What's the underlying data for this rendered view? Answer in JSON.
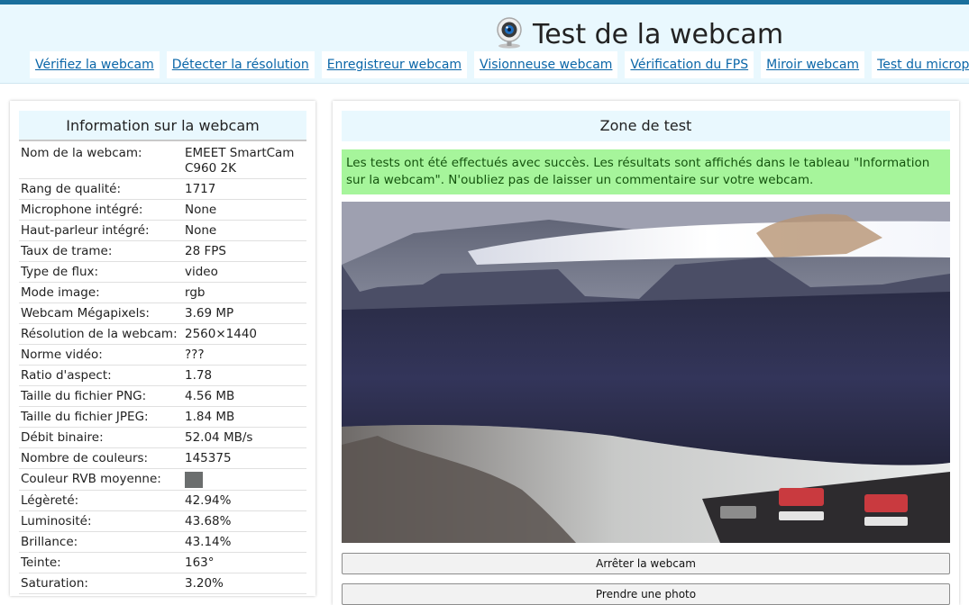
{
  "header": {
    "title": "Test de la webcam",
    "nav": [
      "Vérifiez la webcam",
      "Détecter la résolution",
      "Enregistreur webcam",
      "Visionneuse webcam",
      "Vérification du FPS",
      "Miroir webcam",
      "Test du micropho"
    ]
  },
  "info": {
    "title": "Information sur la webcam",
    "rows": [
      {
        "label": "Nom de la webcam:",
        "value": "EMEET SmartCam C960 2K"
      },
      {
        "label": "Rang de qualité:",
        "value": "1717"
      },
      {
        "label": "Microphone intégré:",
        "value": "None"
      },
      {
        "label": "Haut-parleur intégré:",
        "value": "None"
      },
      {
        "label": "Taux de trame:",
        "value": "28 FPS"
      },
      {
        "label": "Type de flux:",
        "value": "video"
      },
      {
        "label": "Mode image:",
        "value": "rgb"
      },
      {
        "label": "Webcam Mégapixels:",
        "value": "3.69 MP"
      },
      {
        "label": "Résolution de la webcam:",
        "value": "2560×1440"
      },
      {
        "label": "Norme vidéo:",
        "value": "???"
      },
      {
        "label": "Ratio d'aspect:",
        "value": "1.78"
      },
      {
        "label": "Taille du fichier PNG:",
        "value": "4.56 MB"
      },
      {
        "label": "Taille du fichier JPEG:",
        "value": "1.84 MB"
      },
      {
        "label": "Débit binaire:",
        "value": "52.04 MB/s"
      },
      {
        "label": "Nombre de couleurs:",
        "value": "145375"
      },
      {
        "label": "Couleur RVB moyenne:",
        "value": ""
      },
      {
        "label": "Légèreté:",
        "value": "42.94%"
      },
      {
        "label": "Luminosité:",
        "value": "43.68%"
      },
      {
        "label": "Brillance:",
        "value": "43.14%"
      },
      {
        "label": "Teinte:",
        "value": "163°"
      },
      {
        "label": "Saturation:",
        "value": "3.20%"
      }
    ],
    "avg_rgb_color": "#6b6e6e"
  },
  "zone": {
    "title": "Zone de test",
    "success_message": "Les tests ont été effectués avec succès. Les résultats sont affichés dans le tableau \"Information sur la webcam\". N'oubliez pas de laisser un commentaire sur votre webcam.",
    "stop_button": "Arrêter la webcam",
    "photo_button": "Prendre une photo"
  },
  "colors": {
    "accent_bar": "#1a6f9c",
    "header_bg": "#e9f8fe",
    "link": "#0a66a8",
    "success_bg": "#a6f59b",
    "success_text": "#14540e"
  },
  "icons": {
    "title_icon": "webcam-icon"
  }
}
